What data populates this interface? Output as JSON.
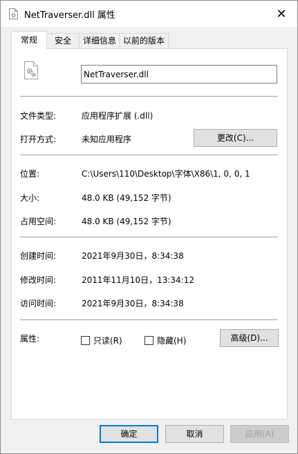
{
  "window": {
    "title": "NetTraverser.dll 属性",
    "close_glyph": "✕"
  },
  "tabs": [
    {
      "label": "常规",
      "active": true
    },
    {
      "label": "安全",
      "active": false
    },
    {
      "label": "详细信息",
      "active": false
    },
    {
      "label": "以前的版本",
      "active": false
    }
  ],
  "general": {
    "file_name": "NetTraverser.dll",
    "file_type_label": "文件类型:",
    "file_type_value": "应用程序扩展 (.dll)",
    "opens_with_label": "打开方式:",
    "opens_with_value": "未知应用程序",
    "change_button": "更改(C)...",
    "location_label": "位置:",
    "location_value": "C:\\Users\\110\\Desktop\\字体\\X86\\1, 0, 0, 1",
    "size_label": "大小:",
    "size_value": "48.0 KB (49,152 字节)",
    "size_on_disk_label": "占用空间:",
    "size_on_disk_value": "48.0 KB (49,152 字节)",
    "created_label": "创建时间:",
    "created_value": "2021年9月30日，8:34:38",
    "modified_label": "修改时间:",
    "modified_value": "2011年11月10日，13:34:12",
    "accessed_label": "访问时间:",
    "accessed_value": "2021年9月30日，8:34:38",
    "attributes_label": "属性:",
    "readonly_label": "只读(R)",
    "readonly_checked": false,
    "hidden_label": "隐藏(H)",
    "hidden_checked": false,
    "advanced_button": "高级(D)..."
  },
  "footer": {
    "ok_button": "确定",
    "cancel_button": "取消",
    "apply_button": "应用(A)",
    "apply_enabled": false
  },
  "colors": {
    "focus_border": "#0078d7",
    "button_face": "#e1e1e1",
    "disabled_text": "#a0a0a0"
  }
}
